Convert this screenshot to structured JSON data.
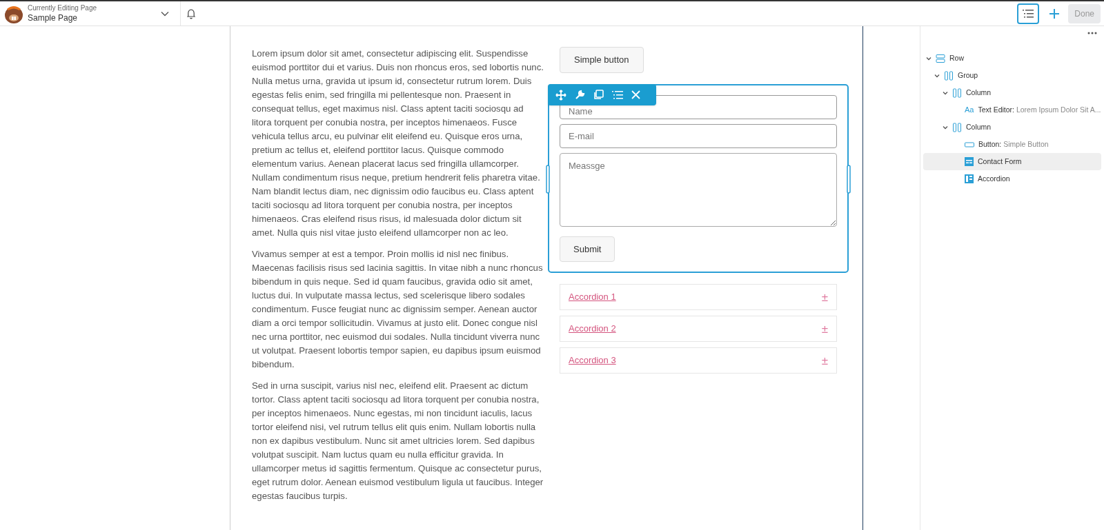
{
  "header": {
    "caption": "Currently Editing Page",
    "page": "Sample Page"
  },
  "toolbar": {
    "outline_selected": true,
    "done": "Done"
  },
  "text_column": [
    "Lorem ipsum dolor sit amet, consectetur adipiscing elit. Suspendisse euismod porttitor dui et varius. Duis non rhoncus eros, sed lobortis nunc. Nulla metus urna, gravida ut ipsum id, consectetur rutrum lorem. Duis egestas felis enim, sed fringilla mi pellentesque non. Praesent in consequat tellus, eget maximus nisl. Class aptent taciti sociosqu ad litora torquent per conubia nostra, per inceptos himenaeos. Fusce vehicula tellus arcu, eu pulvinar elit eleifend eu. Quisque eros urna, pretium ac tellus et, eleifend porttitor lacus. Quisque commodo elementum varius. Aenean placerat lacus sed fringilla ullamcorper. Nullam condimentum risus neque, pretium hendrerit felis pharetra vitae. Nam blandit lectus diam, nec dignissim odio faucibus eu. Class aptent taciti sociosqu ad litora torquent per conubia nostra, per inceptos himenaeos. Cras eleifend risus risus, id malesuada dolor dictum sit amet. Nulla quis nisl vitae justo eleifend ullamcorper non ac leo.",
    "Vivamus semper at est a tempor. Proin mollis id nisl nec finibus. Maecenas facilisis risus sed lacinia sagittis. In vitae nibh a nunc rhoncus bibendum in quis neque. Sed id quam faucibus, gravida odio sit amet, luctus dui. In vulputate massa lectus, sed scelerisque libero sodales condimentum. Fusce feugiat nunc ac dignissim semper. Aenean auctor diam a orci tempor sollicitudin. Vivamus at justo elit. Donec congue nisl nec urna porttitor, nec euismod dui sodales. Nulla tincidunt viverra nunc ut volutpat. Praesent lobortis tempor sapien, eu dapibus ipsum euismod bibendum.",
    "Sed in urna suscipit, varius nisl nec, eleifend elit. Praesent ac dictum tortor. Class aptent taciti sociosqu ad litora torquent per conubia nostra, per inceptos himenaeos. Nunc egestas, mi non tincidunt iaculis, lacus tortor eleifend nisi, vel rutrum tellus elit quis enim. Nullam lobortis nulla non ex dapibus vestibulum. Nunc sit amet ultricies lorem. Sed dapibus volutpat suscipit. Nam luctus quam eu nulla efficitur gravida. In ullamcorper metus id sagittis fermentum. Quisque ac consectetur purus, eget rutrum dolor. Aenean euismod vestibulum ligula ut faucibus. Integer egestas faucibus turpis."
  ],
  "simple_button": "Simple button",
  "contact_form": {
    "fields": [
      {
        "placeholder": "Name",
        "kind": "input"
      },
      {
        "placeholder": "E-mail",
        "kind": "input"
      },
      {
        "placeholder": "Meassge",
        "kind": "textarea"
      }
    ],
    "submit": "Submit"
  },
  "accordions": [
    {
      "title": "Accordion 1",
      "icon": "±"
    },
    {
      "title": "Accordion 2",
      "icon": "±"
    },
    {
      "title": "Accordion 3",
      "icon": "±"
    }
  ],
  "outline": [
    {
      "type": "Row",
      "kind": "row",
      "expanded": true,
      "selected": false,
      "children": [
        {
          "type": "Group",
          "kind": "columns",
          "expanded": true,
          "selected": false,
          "children": [
            {
              "type": "Column",
              "kind": "columns",
              "expanded": true,
              "selected": false,
              "children": [
                {
                  "type": "Text Editor:",
                  "detail": "Lorem Ipsum Dolor Sit A...",
                  "kind": "text",
                  "icon_text": "Aa",
                  "selected": false
                }
              ]
            },
            {
              "type": "Column",
              "kind": "columns",
              "expanded": true,
              "selected": false,
              "children": [
                {
                  "type": "Button:",
                  "detail": "Simple Button",
                  "kind": "button",
                  "selected": false
                },
                {
                  "type": "Contact Form",
                  "kind": "form",
                  "selected": true
                },
                {
                  "type": "Accordion",
                  "kind": "accordion",
                  "selected": false
                }
              ]
            }
          ]
        }
      ]
    }
  ]
}
